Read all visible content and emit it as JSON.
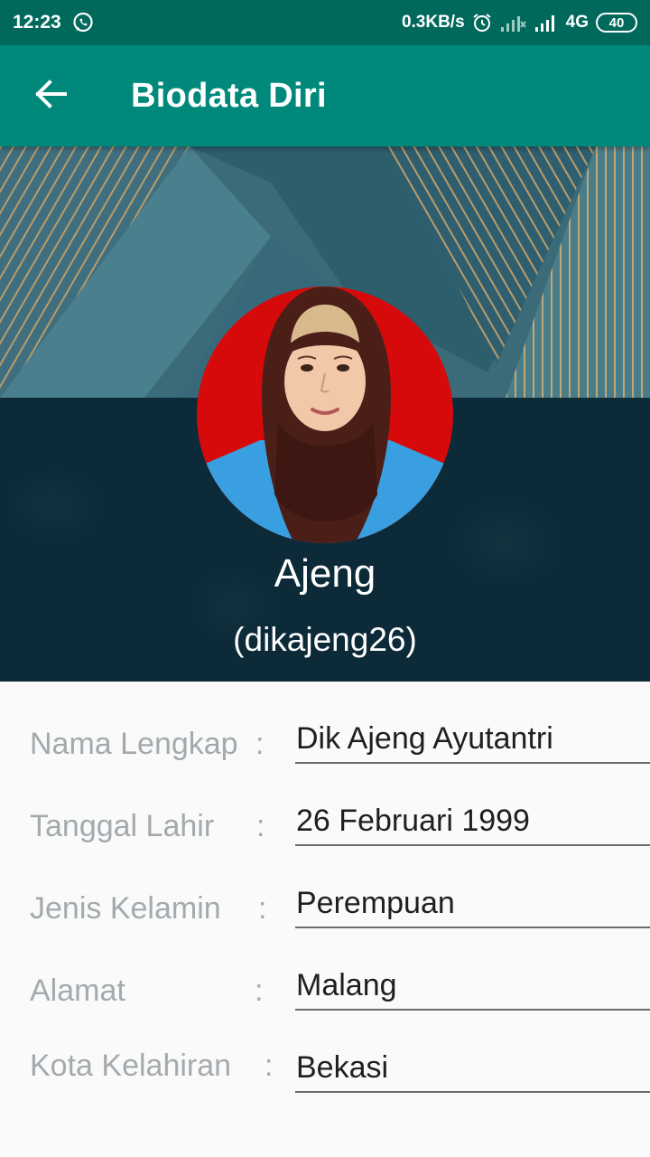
{
  "status_bar": {
    "time": "12:23",
    "net_speed": "0.3KB/s",
    "network": "4G",
    "battery": "40",
    "icons": [
      "whatsapp-icon",
      "alarm-icon",
      "signal-icon",
      "signal-icon",
      "battery-icon"
    ]
  },
  "app_bar": {
    "title": "Biodata Diri",
    "back_icon": "arrow-left-icon",
    "color": "#00897b",
    "status_color": "#00695c"
  },
  "profile": {
    "name": "Ajeng",
    "username": "(dikajeng26)",
    "avatar_icon": "profile-photo"
  },
  "fields": [
    {
      "label": "Nama Lengkap",
      "colon": ":",
      "value": "Dik Ajeng Ayutantri"
    },
    {
      "label": "Tanggal Lahir",
      "colon": ":",
      "value": "26 Februari 1999"
    },
    {
      "label": "Jenis Kelamin",
      "colon": ":",
      "value": "Perempuan"
    },
    {
      "label": "Alamat",
      "colon": ":",
      "value": "Malang"
    },
    {
      "label": "Kota Kelahiran",
      "colon": ":",
      "value": "Bekasi"
    }
  ]
}
